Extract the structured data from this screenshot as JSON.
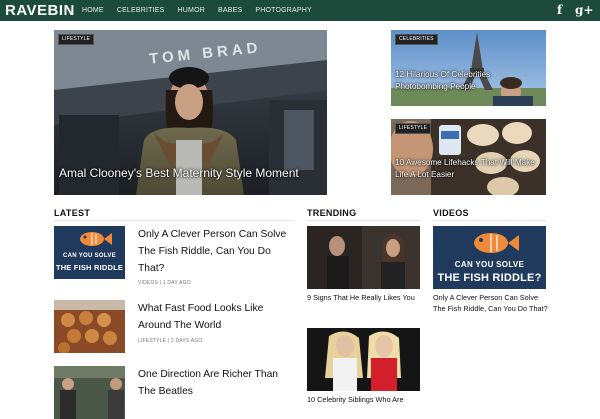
{
  "site": {
    "logo": "RAVEBIN"
  },
  "nav": {
    "items": [
      "HOME",
      "CELEBRITIES",
      "HUMOR",
      "BABES",
      "PHOTOGRAPHY"
    ]
  },
  "social": {
    "facebook": "f",
    "googleplus": "g+"
  },
  "featured": {
    "main": {
      "badge": "LIFESTYLE",
      "title": "Amal Clooney's Best Maternity Style Moment",
      "sign_text": "TOM BRAD"
    },
    "side": [
      {
        "badge": "CELEBRITIES",
        "title": "12 Hilarious Of Celebrities Photobombing People"
      },
      {
        "badge": "LIFESTYLE",
        "title": "10 Awesome Lifehacks That Will Make Life A Lot Easier"
      }
    ]
  },
  "sections": {
    "latest": "LATEST",
    "trending": "TRENDING",
    "videos": "VIDEOS"
  },
  "fish_thumb": {
    "line1": "CAN YOU SOLVE",
    "line2": "THE FISH RIDDLE"
  },
  "fish_thumb_large": {
    "line1": "CAN YOU SOLVE",
    "line2": "THE FISH RIDDLE?"
  },
  "latest": [
    {
      "title": "Only A Clever Person Can Solve The Fish Riddle, Can You Do That?",
      "meta": "VIDEOS | 1 DAY AGO"
    },
    {
      "title": "What Fast Food Looks Like Around The World",
      "meta": "LIFESTYLE | 2 DAYS AGO"
    },
    {
      "title": "One Direction Are Richer Than The Beatles",
      "meta": ""
    }
  ],
  "trending": [
    {
      "title": "9 Signs That He Really Likes You"
    },
    {
      "title": "10 Celebrity Siblings Who Are"
    }
  ],
  "videos": [
    {
      "title": "Only A Clever Person Can Solve The Fish Riddle, Can You Do That?"
    }
  ],
  "colors": {
    "topbar": "#1c4a3b",
    "fish_bg": "#1f3a5c",
    "fish": "#f08a3a"
  }
}
